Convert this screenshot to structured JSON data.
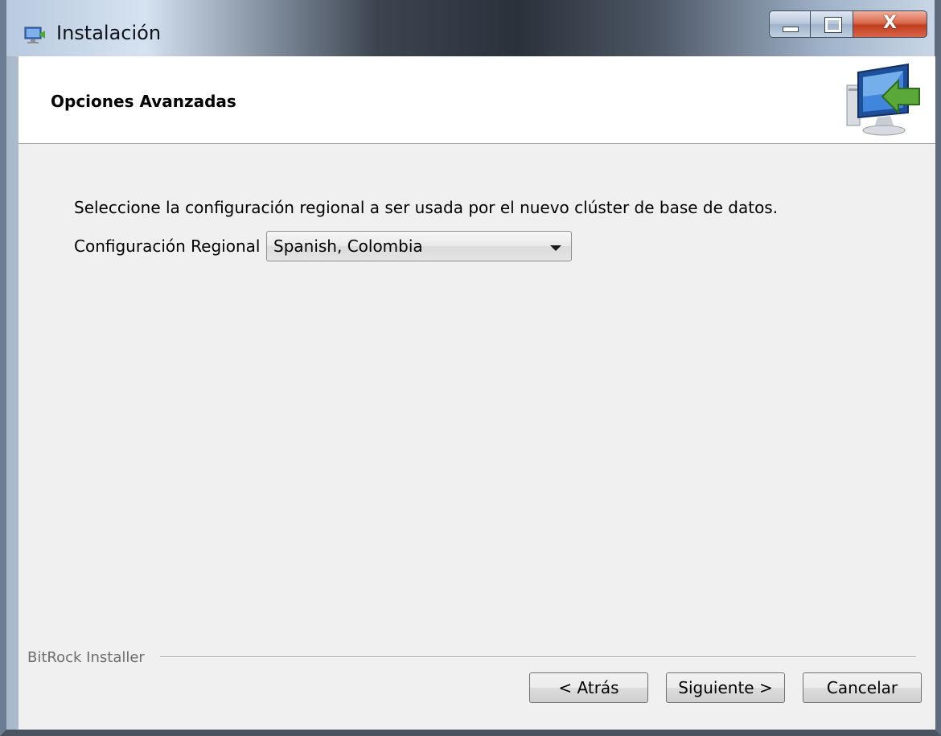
{
  "window": {
    "title": "Instalación",
    "controls": {
      "minimize": "",
      "maximize": "",
      "close": "X"
    }
  },
  "header": {
    "title": "Opciones Avanzadas",
    "icon": "computer-install-icon"
  },
  "main": {
    "instruction": "Seleccione la configuración regional a ser usada por el nuevo clúster de base de datos.",
    "locale_label": "Configuración Regional",
    "locale_value": "Spanish, Colombia"
  },
  "footer": {
    "group_label": "BitRock Installer",
    "back_label": "< Atrás",
    "next_label": "Siguiente >",
    "cancel_label": "Cancelar"
  },
  "colors": {
    "client_bg": "#f0f0f0",
    "header_bg": "#ffffff",
    "close_button": "#c8452a",
    "icon_arrow": "#5aa83a",
    "icon_screen": "#2f6fc4"
  }
}
